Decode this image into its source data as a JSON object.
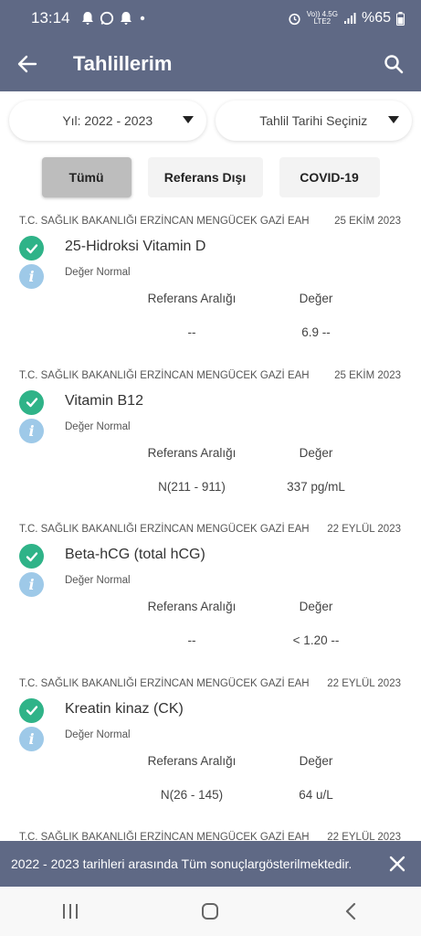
{
  "status_bar": {
    "time": "13:14",
    "network_top": "Vo)) 4.5G",
    "network_bottom": "LTE2",
    "battery": "%65"
  },
  "app_bar": {
    "title": "Tahlillerim"
  },
  "filters": {
    "year": "Yıl: 2022 - 2023",
    "date": "Tahlil Tarihi Seçiniz"
  },
  "tabs": [
    {
      "label": "Tümü"
    },
    {
      "label": "Referans Dışı"
    },
    {
      "label": "COVID-19"
    }
  ],
  "results": [
    {
      "hospital": "T.C. SAĞLIK BAKANLIĞI ERZİNCAN MENGÜCEK GAZİ EAH",
      "date": "25 EKİM 2023",
      "test": "25-Hidroksi Vitamin D",
      "status": "Değer Normal",
      "ref_header": "Referans Aralığı",
      "val_header": "Değer",
      "ref": "--",
      "value": "6.9 --"
    },
    {
      "hospital": "T.C. SAĞLIK BAKANLIĞI ERZİNCAN MENGÜCEK GAZİ EAH",
      "date": "25 EKİM 2023",
      "test": "Vitamin B12",
      "status": "Değer Normal",
      "ref_header": "Referans Aralığı",
      "val_header": "Değer",
      "ref": "N(211 - 911)",
      "value": "337 pg/mL"
    },
    {
      "hospital": "T.C. SAĞLIK BAKANLIĞI ERZİNCAN MENGÜCEK GAZİ EAH",
      "date": "22 EYLÜL 2023",
      "test": "Beta-hCG (total hCG)",
      "status": "Değer Normal",
      "ref_header": "Referans Aralığı",
      "val_header": "Değer",
      "ref": "--",
      "value": "< 1.20 --"
    },
    {
      "hospital": "T.C. SAĞLIK BAKANLIĞI ERZİNCAN MENGÜCEK GAZİ EAH",
      "date": "22 EYLÜL 2023",
      "test": "Kreatin kinaz (CK)",
      "status": "Değer Normal",
      "ref_header": "Referans Aralığı",
      "val_header": "Değer",
      "ref": "N(26 - 145)",
      "value": "64 u/L"
    },
    {
      "hospital": "T.C. SAĞLIK BAKANLIĞI ERZİNCAN MENGÜCEK GAZİ EAH",
      "date": "22 EYLÜL 2023"
    }
  ],
  "snackbar": {
    "message": "2022 - 2023 tarihleri arasında Tüm sonuçlargösterilmektedir."
  },
  "icons": {
    "info_glyph": "i"
  },
  "colors": {
    "primary": "#5f6985",
    "check": "#2fb388",
    "info": "#9ec9e8",
    "active_tab": "#bdbdbd"
  }
}
